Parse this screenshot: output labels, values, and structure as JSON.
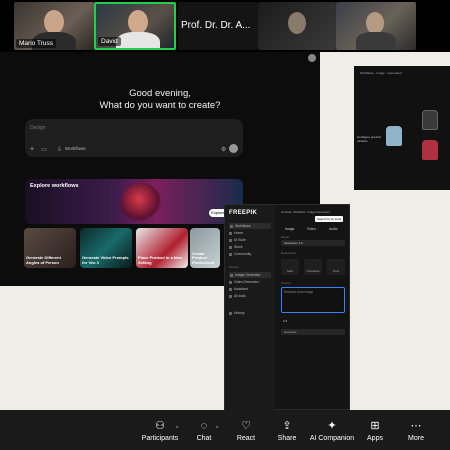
{
  "participants": [
    {
      "name": "Mario Truss"
    },
    {
      "name": "David"
    },
    {
      "name": "Prof. Dr. Dr. A..."
    }
  ],
  "app": {
    "greeting": "Good evening,\nWhat do you want to create?",
    "prompt_placeholder": "Design",
    "workflows_label": "Workflows",
    "explore_label": "Explore workflows",
    "explore_button": "Explore",
    "cards": [
      {
        "label": "Generate Different Angles of Person"
      },
      {
        "label": "Generate Video Prompts for Veo 3"
      },
      {
        "label": "Place Product in a New Setting"
      },
      {
        "label": "Create Product Photoshoot"
      }
    ]
  },
  "freepik": {
    "logo": "FREEPIK",
    "nav": [
      "Workflows",
      "Home",
      "AI Suite",
      "Stock",
      "Community"
    ],
    "section_label": "Pinned",
    "pinned": [
      "Image Generator",
      "Video Generator",
      "Assistant",
      "All tools"
    ],
    "history": "History",
    "top_tabs": [
      "AI Suite",
      "Workflow",
      "Image Generator",
      "Search by AI tools"
    ],
    "mode_tabs": [
      "Image",
      "Video",
      "Audio"
    ],
    "model_label": "Model",
    "model_value": "Seedream 4.0",
    "references_label": "References",
    "ratios": [
      "Start",
      "Character",
      "Style"
    ],
    "prompt_label": "Prompt",
    "prompt_placeholder": "Describe your image",
    "count": "1/4",
    "generate_label": "Generate"
  },
  "preview": {
    "bar_text": "Workflows  ·  Image  ·  Generated",
    "description": "Configure product variants"
  },
  "toolbar": {
    "items": [
      {
        "label": "Participants",
        "icon": "participants-icon",
        "badge": "2"
      },
      {
        "label": "Chat",
        "icon": "chat-icon"
      },
      {
        "label": "React",
        "icon": "react-icon"
      },
      {
        "label": "Share",
        "icon": "share-icon"
      },
      {
        "label": "AI Companion",
        "icon": "ai-companion-icon"
      },
      {
        "label": "Apps",
        "icon": "apps-icon"
      },
      {
        "label": "More",
        "icon": "more-icon"
      }
    ],
    "share_color": "#1fd14a"
  }
}
